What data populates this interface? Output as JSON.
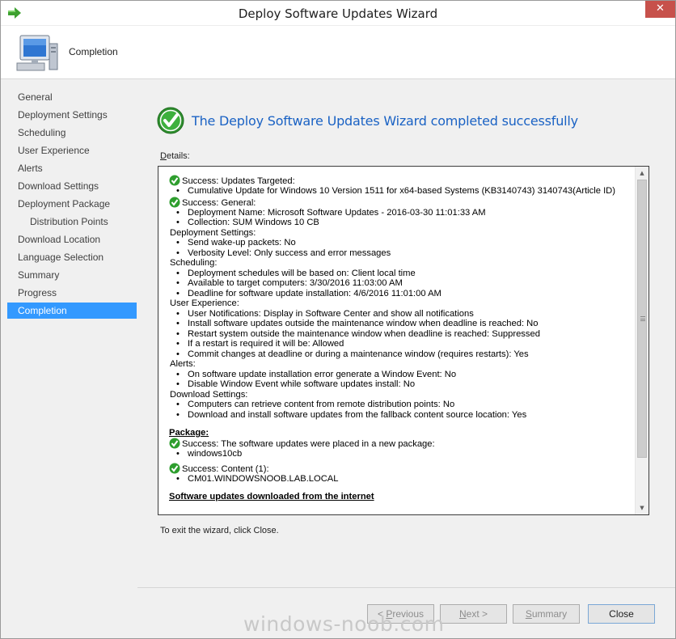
{
  "window": {
    "title": "Deploy Software Updates Wizard",
    "close_glyph": "✕"
  },
  "header": {
    "title": "Completion"
  },
  "nav": {
    "items": [
      {
        "label": "General"
      },
      {
        "label": "Deployment Settings"
      },
      {
        "label": "Scheduling"
      },
      {
        "label": "User Experience"
      },
      {
        "label": "Alerts"
      },
      {
        "label": "Download Settings"
      },
      {
        "label": "Deployment Package"
      },
      {
        "label": "Distribution Points"
      },
      {
        "label": "Download Location"
      },
      {
        "label": "Language Selection"
      },
      {
        "label": "Summary"
      },
      {
        "label": "Progress"
      },
      {
        "label": "Completion"
      }
    ],
    "active": "Completion"
  },
  "main": {
    "heading": "The Deploy Software Updates Wizard completed successfully",
    "details_label_first": "D",
    "details_label_rest": "etails:",
    "exit_text": "To exit the wizard, click Close."
  },
  "details": {
    "success_targeted": "Success: Updates Targeted:",
    "targeted_item": "Cumulative Update for Windows 10 Version 1511 for x64-based Systems (KB3140743) 3140743(Article ID)",
    "success_general": "Success: General:",
    "general_items": [
      "Deployment Name: Microsoft Software Updates - 2016-03-30 11:01:33 AM",
      "Collection: SUM Windows 10 CB"
    ],
    "deployment_settings": "Deployment Settings:",
    "deployment_items": [
      "Send wake-up packets: No",
      "Verbosity Level: Only success and error messages"
    ],
    "scheduling": "Scheduling:",
    "scheduling_items": [
      "Deployment schedules will be based on: Client local time",
      "Available to target computers: 3/30/2016 11:03:00 AM",
      "Deadline for software update installation: 4/6/2016 11:01:00 AM"
    ],
    "user_experience": "User Experience:",
    "ux_items": [
      "User Notifications: Display in Software Center and show all notifications",
      "Install software updates outside the maintenance window when deadline is reached: No",
      "Restart system outside the maintenance window when deadline is reached: Suppressed",
      "If a restart is required it will be: Allowed",
      "Commit changes at deadline or during a maintenance window (requires restarts): Yes"
    ],
    "alerts": "Alerts:",
    "alert_items": [
      "On software update installation error generate a Window Event: No",
      "Disable Window Event while software updates install: No"
    ],
    "download_settings": "Download Settings:",
    "download_items": [
      "Computers can retrieve content from remote distribution points: No",
      "Download and install software updates from the fallback content source location: Yes"
    ],
    "package_heading": "Package:",
    "success_package": "Success: The software updates were placed in a new package:",
    "package_item": "windows10cb",
    "success_content": "Success: Content (1):",
    "content_item": "CM01.WINDOWSNOOB.LAB.LOCAL",
    "downloaded_heading": "Software updates downloaded from the internet"
  },
  "buttons": {
    "previous_ak": "P",
    "previous_rest": "revious",
    "previous_prefix": "< ",
    "next_ak": "N",
    "next_rest": "ext >",
    "summary_ak": "S",
    "summary_rest": "ummary",
    "close": "Close"
  },
  "watermark": "windows-noob.com",
  "colors": {
    "accent": "#3399ff",
    "heading": "#1a62c4",
    "close_button": "#c7514b",
    "success_green": "#2e9e2e"
  }
}
